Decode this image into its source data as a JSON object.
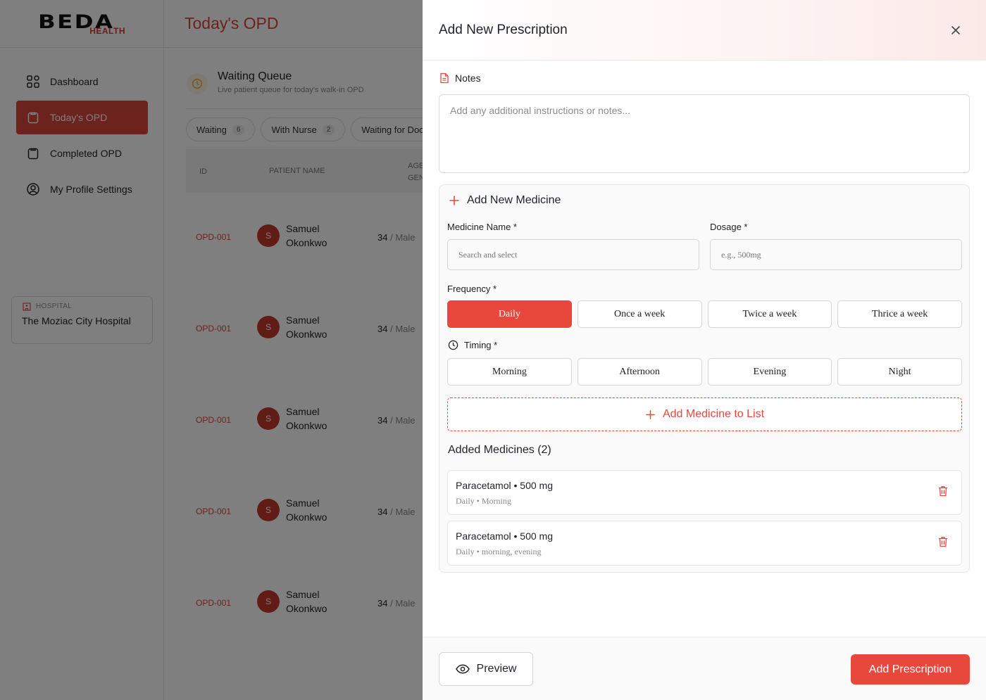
{
  "brand": {
    "logo_text": "BEDA",
    "logo_sub": "HEALTH",
    "accent": "#e8483b"
  },
  "sidebar": {
    "items": [
      {
        "label": "Dashboard",
        "icon": "grid-icon"
      },
      {
        "label": "Today's OPD",
        "icon": "clipboard-icon",
        "active": true
      },
      {
        "label": "Completed OPD",
        "icon": "clipboard-icon"
      },
      {
        "label": "My Profile Settings",
        "icon": "user-circle-icon"
      }
    ],
    "hospital_label": "HOSPITAL",
    "hospital_name": "The Moziac City Hospital"
  },
  "main": {
    "title": "Today's OPD",
    "queue_title": "Waiting Queue",
    "queue_subtitle": "Live patient queue for today's walk-in OPD",
    "filters": [
      {
        "label": "Waiting",
        "count": "6"
      },
      {
        "label": "With Nurse",
        "count": "2"
      },
      {
        "label": "Waiting for Doc",
        "count": ""
      }
    ],
    "columns": {
      "id": "ID",
      "name": "PATIENT NAME",
      "age_line1": "AGE",
      "age_line2": "GEN"
    },
    "rows": [
      {
        "id": "OPD-001",
        "initial": "S",
        "name": "Samuel Okonkwo",
        "age": "34",
        "gender": "/ Male"
      },
      {
        "id": "OPD-001",
        "initial": "S",
        "name": "Samuel Okonkwo",
        "age": "34",
        "gender": "/ Male"
      },
      {
        "id": "OPD-001",
        "initial": "S",
        "name": "Samuel Okonkwo",
        "age": "34",
        "gender": "/ Male"
      },
      {
        "id": "OPD-001",
        "initial": "S",
        "name": "Samuel Okonkwo",
        "age": "34",
        "gender": "/ Male"
      },
      {
        "id": "OPD-001",
        "initial": "S",
        "name": "Samuel Okonkwo",
        "age": "34",
        "gender": "/ Male"
      }
    ]
  },
  "drawer": {
    "title": "Add New Prescription",
    "notes_label": "Notes",
    "notes_placeholder": "Add any additional instructions or notes...",
    "notes_value": "",
    "medicine_section_title": "Add New Medicine",
    "medicine_name_label": "Medicine Name *",
    "medicine_name_placeholder": "Search and select",
    "dosage_label": "Dosage *",
    "dosage_placeholder": "e.g., 500mg",
    "frequency_label": "Frequency *",
    "frequency_options": [
      "Daily",
      "Once a week",
      "Twice a week",
      "Thrice a week"
    ],
    "frequency_selected": "Daily",
    "timing_label": "Timing *",
    "timing_options": [
      "Morning",
      "Afternoon",
      "Evening",
      "Night"
    ],
    "add_medicine_label": "Add Medicine to List",
    "added_title": "Added Medicines (2)",
    "added_medicines": [
      {
        "name": "Paracetamol",
        "dose": "500 mg",
        "meta": "Daily • Morning"
      },
      {
        "name": "Paracetamol",
        "dose": "500 mg",
        "meta": "Daily • morning, evening"
      }
    ],
    "preview_label": "Preview",
    "submit_label": "Add Prescription"
  }
}
